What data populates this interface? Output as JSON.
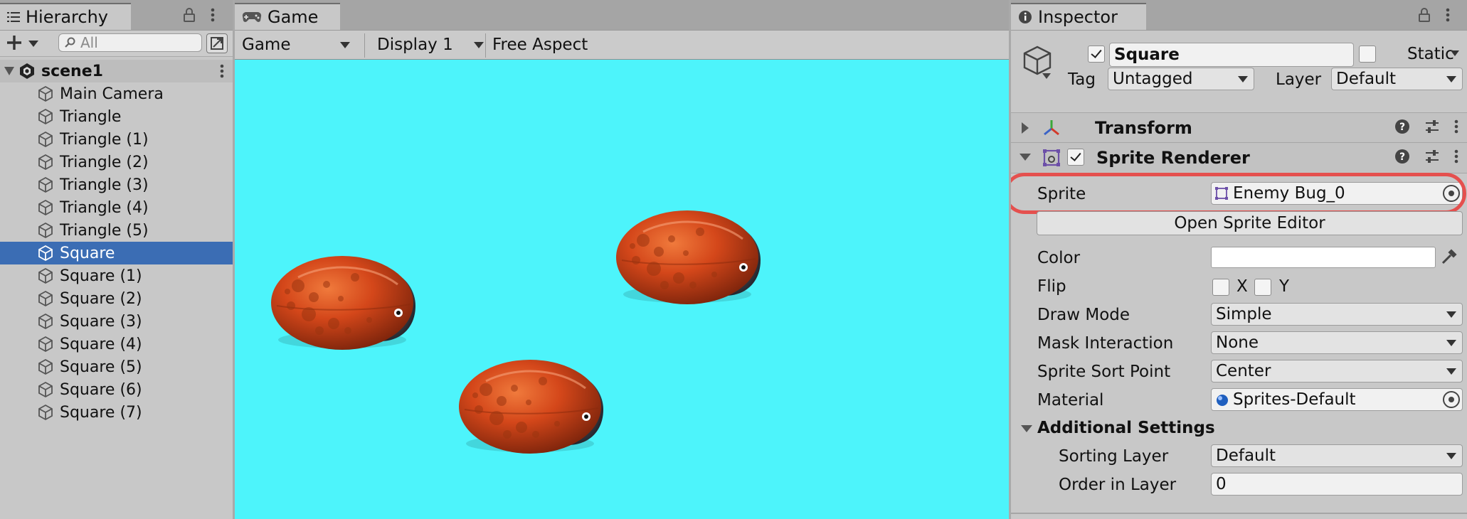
{
  "hierarchy": {
    "tab_label": "Hierarchy",
    "search_placeholder": "All",
    "scene_name": "scene1",
    "items": [
      {
        "label": "Main Camera"
      },
      {
        "label": "Triangle"
      },
      {
        "label": "Triangle (1)"
      },
      {
        "label": "Triangle (2)"
      },
      {
        "label": "Triangle (3)"
      },
      {
        "label": "Triangle (4)"
      },
      {
        "label": "Triangle (5)"
      },
      {
        "label": "Square",
        "selected": true
      },
      {
        "label": "Square (1)"
      },
      {
        "label": "Square (2)"
      },
      {
        "label": "Square (3)"
      },
      {
        "label": "Square (4)"
      },
      {
        "label": "Square (5)"
      },
      {
        "label": "Square (6)"
      },
      {
        "label": "Square (7)"
      }
    ]
  },
  "game": {
    "tab_label": "Game",
    "mode_dropdown": "Game",
    "display_dropdown": "Display 1",
    "aspect_dropdown": "Free Aspect",
    "background_color": "#4df4fb"
  },
  "inspector": {
    "tab_label": "Inspector",
    "object_name": "Square",
    "active": true,
    "static_label": "Static",
    "static": false,
    "tag_label": "Tag",
    "tag_value": "Untagged",
    "layer_label": "Layer",
    "layer_value": "Default",
    "transform": {
      "title": "Transform"
    },
    "sprite_renderer": {
      "title": "Sprite Renderer",
      "enabled": true,
      "sprite_label": "Sprite",
      "sprite_value": "Enemy Bug_0",
      "open_editor_label": "Open Sprite Editor",
      "color_label": "Color",
      "color_value": "#ffffff",
      "flip_label": "Flip",
      "flip_x_label": "X",
      "flip_y_label": "Y",
      "flip_x": false,
      "flip_y": false,
      "draw_mode_label": "Draw Mode",
      "draw_mode_value": "Simple",
      "mask_label": "Mask Interaction",
      "mask_value": "None",
      "sort_point_label": "Sprite Sort Point",
      "sort_point_value": "Center",
      "material_label": "Material",
      "material_value": "Sprites-Default",
      "additional_settings_label": "Additional Settings",
      "sorting_layer_label": "Sorting Layer",
      "sorting_layer_value": "Default",
      "order_label": "Order in Layer",
      "order_value": "0"
    },
    "highlight_color": "#e5504e"
  }
}
